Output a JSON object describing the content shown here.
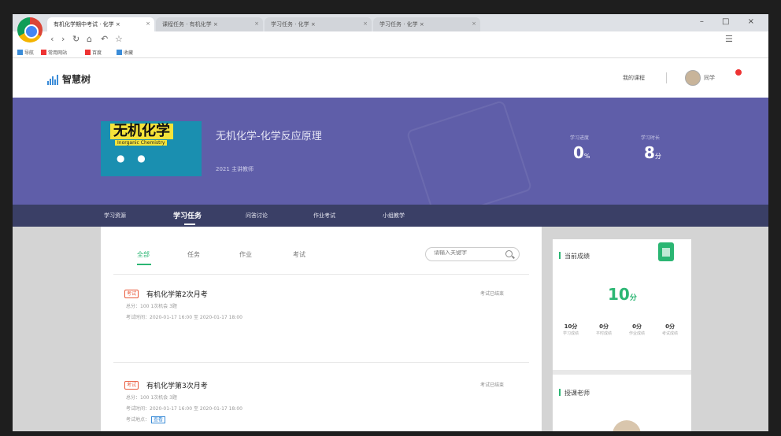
{
  "browser": {
    "tabs": [
      "有机化学期中考试 · 化学 ×",
      "课程任务 · 有机化学 ×",
      "学习任务 · 化学 ×",
      "学习任务 · 化学 ×"
    ],
    "window_controls": "– □ ×",
    "bookmarks": [
      "导航",
      "常用网站",
      "百度",
      "收藏"
    ]
  },
  "site": {
    "logo_text": "智慧树",
    "my_course": "我的课程",
    "username": "同学"
  },
  "course": {
    "cover_title": "无机化学",
    "cover_subtitle": "Inorganic Chemistry",
    "title": "无机化学-化学反应原理",
    "teacher_line": "2021 主讲教师",
    "stats": [
      {
        "label": "学习进度",
        "value": "0",
        "unit": "%"
      },
      {
        "label": "学习时长",
        "value": "8",
        "unit": "分"
      }
    ]
  },
  "course_nav": [
    "学习资源",
    "学习任务",
    "问答讨论",
    "作业考试",
    "小组教学"
  ],
  "filter_tabs": [
    "全部",
    "任务",
    "作业",
    "考试"
  ],
  "search": {
    "placeholder": "请输入关键字"
  },
  "tasks": [
    {
      "badge": "考试",
      "title": "有机化学第2次月考",
      "meta1": "总分：100    1次机会  3题",
      "meta2": "考试时间：2020-01-17 16:00 至 2020-01-17 18:00",
      "meta3": "",
      "link": "",
      "status": "考试已结束"
    },
    {
      "badge": "考试",
      "title": "有机化学第3次月考",
      "meta1": "总分：100    1次机会  3题",
      "meta2": "考试时间：2020-01-17 16:00 至 2020-01-17 18:00",
      "meta3": "考试地点：",
      "link": "查看",
      "status": "考试已结束"
    }
  ],
  "side": {
    "score_heading": "当前成绩",
    "score": "10",
    "score_unit": "分",
    "mini_stats": [
      {
        "value": "10",
        "unit": "分",
        "label": "学习成绩"
      },
      {
        "value": "0",
        "unit": "分",
        "label": "平时成绩"
      },
      {
        "value": "0",
        "unit": "分",
        "label": "作业成绩"
      },
      {
        "value": "0",
        "unit": "分",
        "label": "考试成绩"
      }
    ],
    "teacher_heading": "授课老师"
  }
}
